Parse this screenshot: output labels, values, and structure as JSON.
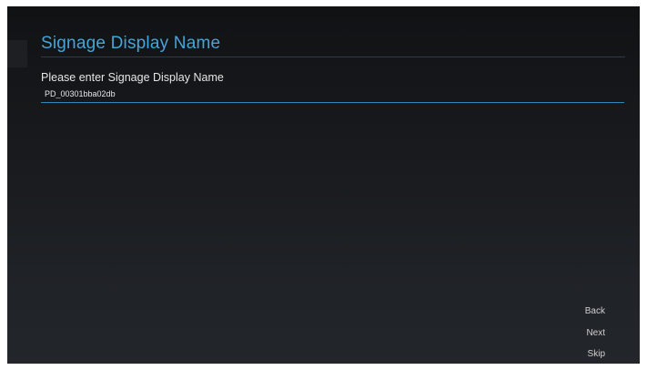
{
  "page": {
    "title": "Signage Display Name",
    "prompt": "Please enter Signage Display Name"
  },
  "input": {
    "value": "PD_00301bba02db"
  },
  "nav": {
    "back_label": "Back",
    "next_label": "Next",
    "skip_label": "Skip"
  },
  "colors": {
    "accent": "#43a6d8",
    "underline": "#2e87b8",
    "background_top": "#111214",
    "background_bottom": "#23272b"
  }
}
